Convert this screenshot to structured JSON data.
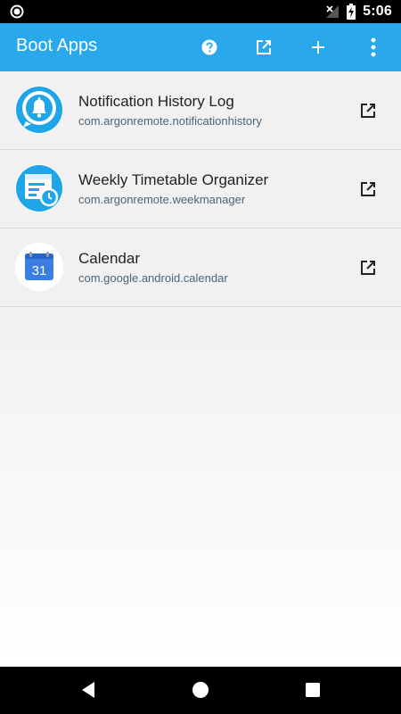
{
  "status_bar": {
    "time": "5:06",
    "icons": [
      "record-icon",
      "signal-off-icon",
      "battery-charging-icon"
    ]
  },
  "app_bar": {
    "title": "Boot Apps",
    "actions": [
      "help-icon",
      "open-external-icon",
      "add-icon",
      "overflow-menu-icon"
    ],
    "background": "#29a9ec"
  },
  "apps": [
    {
      "name": "Notification History Log",
      "package": "com.argonremote.notificationhistory",
      "icon": "bell-icon"
    },
    {
      "name": "Weekly Timetable Organizer",
      "package": "com.argonremote.weekmanager",
      "icon": "timetable-icon"
    },
    {
      "name": "Calendar",
      "package": "com.google.android.calendar",
      "icon": "calendar-icon",
      "icon_text": "31"
    }
  ],
  "nav_bar": {
    "buttons": [
      "back-icon",
      "home-icon",
      "recents-icon"
    ]
  }
}
